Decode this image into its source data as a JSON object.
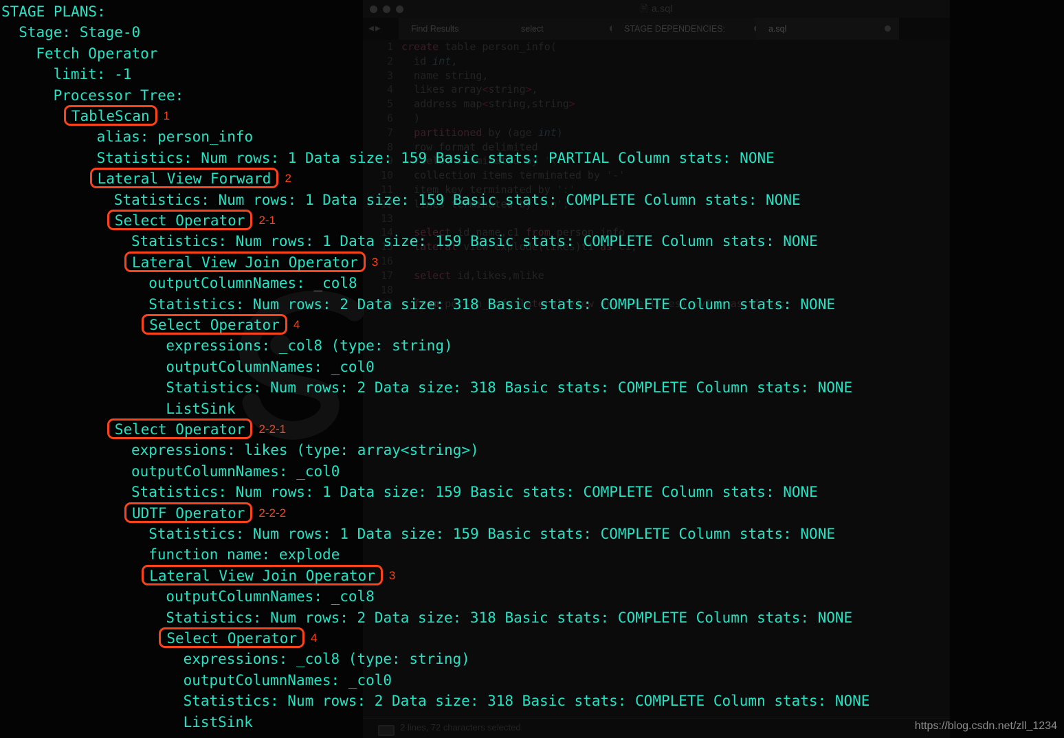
{
  "ide": {
    "title": "a.sql",
    "title_icon": "file-icon",
    "traffic_lights": [
      "close-button",
      "minimize-button",
      "maximize-button"
    ],
    "nav_back_icon": "nav-back-icon",
    "nav_forward_icon": "nav-forward-icon",
    "tabs": [
      {
        "label": "Find Results",
        "close": "×",
        "active": false
      },
      {
        "label": "select",
        "dot": true,
        "active": false
      },
      {
        "label": "STAGE DEPENDENCIES:",
        "dot": true,
        "active": false
      },
      {
        "label": "a.sql",
        "dot": true,
        "active": true
      }
    ],
    "code_lines": [
      {
        "n": "1",
        "text": "create table person_info("
      },
      {
        "n": "2",
        "text": "id int,"
      },
      {
        "n": "3",
        "text": "name string,"
      },
      {
        "n": "4",
        "text": "likes array<string>,"
      },
      {
        "n": "5",
        "text": "address map<string,string>"
      },
      {
        "n": "6",
        "text": ")"
      },
      {
        "n": "7",
        "text": "partitioned by (age int)"
      },
      {
        "n": "8",
        "text": "row format delimited"
      },
      {
        "n": "9",
        "text": "fields terminated by '\\t'"
      },
      {
        "n": "10",
        "text": "collection items terminated by '-'"
      },
      {
        "n": "11",
        "text": "item key terminated by ':'"
      },
      {
        "n": "12",
        "text": "lines terminated by '\\n';"
      },
      {
        "n": "13",
        "text": ""
      },
      {
        "n": "14",
        "text": "select id,name,c1 from person_info"
      },
      {
        "n": "15",
        "text": "lateral view explode(likes)t1 as c1;"
      },
      {
        "n": "16",
        "text": ""
      },
      {
        "n": "17",
        "text": "select id,likes,mlike"
      },
      {
        "n": "18",
        "text": ""
      },
      {
        "n": "19",
        "text": "from person_info lateral view explode(likes) myTab as mlike;"
      }
    ],
    "status_bar": {
      "icon": "selection-icon",
      "text": "2 lines, 72 characters selected"
    }
  },
  "plan": {
    "colors": {
      "text": "#24e3c4",
      "annotation": "#f9431a",
      "background": "#040404"
    },
    "lines": [
      {
        "indent": 0,
        "text": "STAGE PLANS:",
        "boxed": false,
        "tag": ""
      },
      {
        "indent": 2,
        "text": "Stage: Stage-0",
        "boxed": false,
        "tag": ""
      },
      {
        "indent": 4,
        "text": "Fetch Operator",
        "boxed": false,
        "tag": ""
      },
      {
        "indent": 6,
        "text": "limit: -1",
        "boxed": false,
        "tag": ""
      },
      {
        "indent": 6,
        "text": "Processor Tree:",
        "boxed": false,
        "tag": ""
      },
      {
        "indent": 8,
        "text": "TableScan",
        "boxed": true,
        "tag": "1"
      },
      {
        "indent": 11,
        "text": "alias: person_info",
        "boxed": false,
        "tag": ""
      },
      {
        "indent": 11,
        "text": "Statistics: Num rows: 1 Data size: 159 Basic stats: PARTIAL Column stats: NONE",
        "boxed": false,
        "tag": ""
      },
      {
        "indent": 11,
        "text": "Lateral View Forward",
        "boxed": true,
        "tag": "2"
      },
      {
        "indent": 13,
        "text": "Statistics: Num rows: 1 Data size: 159 Basic stats: COMPLETE Column stats: NONE",
        "boxed": false,
        "tag": ""
      },
      {
        "indent": 13,
        "text": "Select Operator",
        "boxed": true,
        "tag": "2-1"
      },
      {
        "indent": 15,
        "text": "Statistics: Num rows: 1 Data size: 159 Basic stats: COMPLETE Column stats: NONE",
        "boxed": false,
        "tag": ""
      },
      {
        "indent": 15,
        "text": "Lateral View Join Operator",
        "boxed": true,
        "tag": "3"
      },
      {
        "indent": 17,
        "text": "outputColumnNames: _col8",
        "boxed": false,
        "tag": ""
      },
      {
        "indent": 17,
        "text": "Statistics: Num rows: 2 Data size: 318 Basic stats: COMPLETE Column stats: NONE",
        "boxed": false,
        "tag": ""
      },
      {
        "indent": 17,
        "text": "Select Operator",
        "boxed": true,
        "tag": "4"
      },
      {
        "indent": 19,
        "text": "expressions: _col8 (type: string)",
        "boxed": false,
        "tag": ""
      },
      {
        "indent": 19,
        "text": "outputColumnNames: _col0",
        "boxed": false,
        "tag": ""
      },
      {
        "indent": 19,
        "text": "Statistics: Num rows: 2 Data size: 318 Basic stats: COMPLETE Column stats: NONE",
        "boxed": false,
        "tag": ""
      },
      {
        "indent": 19,
        "text": "ListSink",
        "boxed": false,
        "tag": ""
      },
      {
        "indent": 13,
        "text": "Select Operator",
        "boxed": true,
        "tag": "2-2-1"
      },
      {
        "indent": 15,
        "text": "expressions: likes (type: array<string>)",
        "boxed": false,
        "tag": ""
      },
      {
        "indent": 15,
        "text": "outputColumnNames: _col0",
        "boxed": false,
        "tag": ""
      },
      {
        "indent": 15,
        "text": "Statistics: Num rows: 1 Data size: 159 Basic stats: COMPLETE Column stats: NONE",
        "boxed": false,
        "tag": ""
      },
      {
        "indent": 15,
        "text": "UDTF Operator",
        "boxed": true,
        "tag": "2-2-2"
      },
      {
        "indent": 17,
        "text": "Statistics: Num rows: 1 Data size: 159 Basic stats: COMPLETE Column stats: NONE",
        "boxed": false,
        "tag": ""
      },
      {
        "indent": 17,
        "text": "function name: explode",
        "boxed": false,
        "tag": ""
      },
      {
        "indent": 17,
        "text": "Lateral View Join Operator",
        "boxed": true,
        "tag": "3"
      },
      {
        "indent": 19,
        "text": "outputColumnNames: _col8",
        "boxed": false,
        "tag": ""
      },
      {
        "indent": 19,
        "text": "Statistics: Num rows: 2 Data size: 318 Basic stats: COMPLETE Column stats: NONE",
        "boxed": false,
        "tag": ""
      },
      {
        "indent": 19,
        "text": "Select Operator",
        "boxed": true,
        "tag": "4"
      },
      {
        "indent": 21,
        "text": "expressions: _col8 (type: string)",
        "boxed": false,
        "tag": ""
      },
      {
        "indent": 21,
        "text": "outputColumnNames: _col0",
        "boxed": false,
        "tag": ""
      },
      {
        "indent": 21,
        "text": "Statistics: Num rows: 2 Data size: 318 Basic stats: COMPLETE Column stats: NONE",
        "boxed": false,
        "tag": ""
      },
      {
        "indent": 21,
        "text": "ListSink",
        "boxed": false,
        "tag": ""
      }
    ]
  },
  "watermark": {
    "url": "https://blog.csdn.net/zll_1234"
  }
}
